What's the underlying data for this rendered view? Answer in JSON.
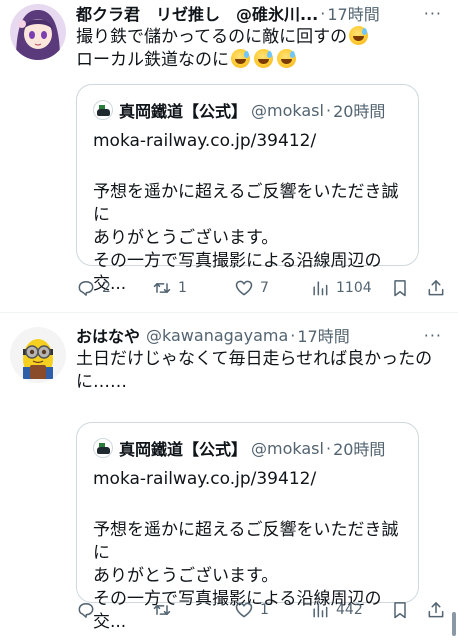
{
  "colors": {
    "text": "#0f1419",
    "secondary": "#536471",
    "border": "#cfd9de",
    "divider": "#eff3f4"
  },
  "tweets": [
    {
      "display_name": "都クラ君　リゼ推し　@碓氷川...",
      "time": "17時間",
      "lines": [
        "撮り鉄で儲かってるのに敵に回すの",
        "ローカル鉄道なのに"
      ],
      "emoji_icon": "sweat-smile-emoji",
      "quote": {
        "name": "真岡鐵道【公式】",
        "handle": "@mokasl",
        "time": "20時間",
        "link": "moka-railway.co.jp/39412/",
        "lines": [
          "予想を遥かに超えるご反響をいただき誠に",
          "ありがとうございます。",
          "その一方で写真撮影による沿線周辺の交..."
        ]
      },
      "stats": {
        "replies": "2",
        "retweets": "1",
        "likes": "7",
        "views": "1104"
      }
    },
    {
      "display_name": "おはなや",
      "handle": "@kawanagayama",
      "time": "17時間",
      "lines": [
        "土日だけじゃなくて毎日走らせれば良かったの",
        "に……"
      ],
      "quote": {
        "name": "真岡鐵道【公式】",
        "handle": "@mokasl",
        "time": "20時間",
        "link": "moka-railway.co.jp/39412/",
        "lines": [
          "予想を遥かに超えるご反響をいただき誠に",
          "ありがとうございます。",
          "その一方で写真撮影による沿線周辺の交..."
        ]
      },
      "stats": {
        "replies": "",
        "retweets": "",
        "likes": "1",
        "views": "442"
      }
    }
  ],
  "separator": "·",
  "more": "···"
}
